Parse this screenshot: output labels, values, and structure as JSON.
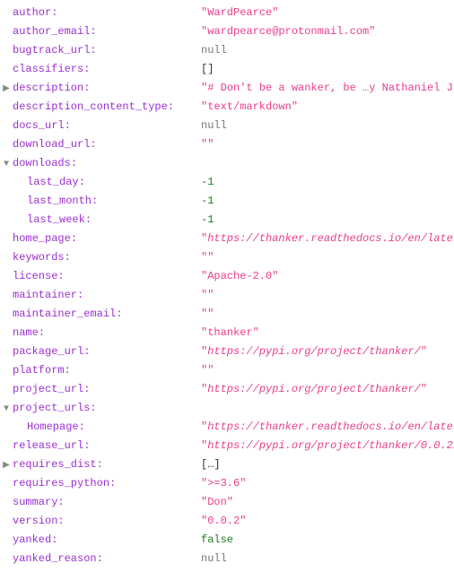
{
  "rows": [
    {
      "key": "author",
      "value": "\"WardPearce\"",
      "vtype": "string",
      "indent": 0,
      "toggle": ""
    },
    {
      "key": "author_email",
      "value": "\"wardpearce@protonmail.com\"",
      "vtype": "string",
      "indent": 0,
      "toggle": ""
    },
    {
      "key": "bugtrack_url",
      "value": "null",
      "vtype": "null",
      "indent": 0,
      "toggle": ""
    },
    {
      "key": "classifiers",
      "value": "[]",
      "vtype": "bracket",
      "indent": 0,
      "toggle": ""
    },
    {
      "key": "description",
      "value": "\"# Don't be a wanker, be …y Nathaniel J. Smith\\n\\n\"",
      "vtype": "string",
      "indent": 0,
      "toggle": "▶"
    },
    {
      "key": "description_content_type",
      "value": "\"text/markdown\"",
      "vtype": "string",
      "indent": 0,
      "toggle": ""
    },
    {
      "key": "docs_url",
      "value": "null",
      "vtype": "null",
      "indent": 0,
      "toggle": ""
    },
    {
      "key": "download_url",
      "value": "\"\"",
      "vtype": "string",
      "indent": 0,
      "toggle": ""
    },
    {
      "key": "downloads",
      "value": "",
      "vtype": "none",
      "indent": 0,
      "toggle": "▼"
    },
    {
      "key": "last_day",
      "value": "-1",
      "vtype": "number",
      "indent": 1,
      "toggle": ""
    },
    {
      "key": "last_month",
      "value": "-1",
      "vtype": "number",
      "indent": 1,
      "toggle": ""
    },
    {
      "key": "last_week",
      "value": "-1",
      "vtype": "number",
      "indent": 1,
      "toggle": ""
    },
    {
      "key": "home_page",
      "value": "\"https://thanker.readthedocs.io/en/latest/\"",
      "vtype": "string-italic",
      "indent": 0,
      "toggle": ""
    },
    {
      "key": "keywords",
      "value": "\"\"",
      "vtype": "string",
      "indent": 0,
      "toggle": ""
    },
    {
      "key": "license",
      "value": "\"Apache-2.0\"",
      "vtype": "string",
      "indent": 0,
      "toggle": ""
    },
    {
      "key": "maintainer",
      "value": "\"\"",
      "vtype": "string",
      "indent": 0,
      "toggle": ""
    },
    {
      "key": "maintainer_email",
      "value": "\"\"",
      "vtype": "string",
      "indent": 0,
      "toggle": ""
    },
    {
      "key": "name",
      "value": "\"thanker\"",
      "vtype": "string",
      "indent": 0,
      "toggle": ""
    },
    {
      "key": "package_url",
      "value": "\"https://pypi.org/project/thanker/\"",
      "vtype": "string-italic",
      "indent": 0,
      "toggle": ""
    },
    {
      "key": "platform",
      "value": "\"\"",
      "vtype": "string",
      "indent": 0,
      "toggle": ""
    },
    {
      "key": "project_url",
      "value": "\"https://pypi.org/project/thanker/\"",
      "vtype": "string-italic",
      "indent": 0,
      "toggle": ""
    },
    {
      "key": "project_urls",
      "value": "",
      "vtype": "none",
      "indent": 0,
      "toggle": "▼"
    },
    {
      "key": "Homepage",
      "value": "\"https://thanker.readthedocs.io/en/latest/\"",
      "vtype": "string-italic",
      "indent": 1,
      "toggle": ""
    },
    {
      "key": "release_url",
      "value": "\"https://pypi.org/project/thanker/0.0.2/\"",
      "vtype": "string-italic",
      "indent": 0,
      "toggle": ""
    },
    {
      "key": "requires_dist",
      "value": "[…]",
      "vtype": "bracket",
      "indent": 0,
      "toggle": "▶"
    },
    {
      "key": "requires_python",
      "value": "\">=3.6\"",
      "vtype": "string",
      "indent": 0,
      "toggle": ""
    },
    {
      "key": "summary",
      "value": "\"Don\"",
      "vtype": "string",
      "indent": 0,
      "toggle": ""
    },
    {
      "key": "version",
      "value": "\"0.0.2\"",
      "vtype": "string",
      "indent": 0,
      "toggle": ""
    },
    {
      "key": "yanked",
      "value": "false",
      "vtype": "bool",
      "indent": 0,
      "toggle": ""
    },
    {
      "key": "yanked_reason",
      "value": "null",
      "vtype": "null",
      "indent": 0,
      "toggle": ""
    }
  ]
}
